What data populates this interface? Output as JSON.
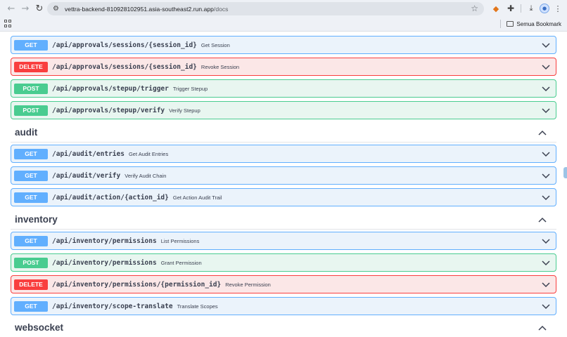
{
  "browser": {
    "url_domain": "vettra-backend-810928102951.asia-southeast2.run.app",
    "url_path": "/docs",
    "bookmarks_label": "Semua Bookmark"
  },
  "operations": [
    {
      "method": "GET",
      "path": "/api/approvals/sessions/{session_id}",
      "summary": "Get Session"
    },
    {
      "method": "DELETE",
      "path": "/api/approvals/sessions/{session_id}",
      "summary": "Revoke Session"
    },
    {
      "method": "POST",
      "path": "/api/approvals/stepup/trigger",
      "summary": "Trigger Stepup"
    },
    {
      "method": "POST",
      "path": "/api/approvals/stepup/verify",
      "summary": "Verify Stepup"
    },
    {
      "method": "GET",
      "path": "/api/audit/entries",
      "summary": "Get Audit Entries"
    },
    {
      "method": "GET",
      "path": "/api/audit/verify",
      "summary": "Verify Audit Chain"
    },
    {
      "method": "GET",
      "path": "/api/audit/action/{action_id}",
      "summary": "Get Action Audit Trail"
    },
    {
      "method": "GET",
      "path": "/api/inventory/permissions",
      "summary": "List Permissions"
    },
    {
      "method": "POST",
      "path": "/api/inventory/permissions",
      "summary": "Grant Permission"
    },
    {
      "method": "DELETE",
      "path": "/api/inventory/permissions/{permission_id}",
      "summary": "Revoke Permission"
    },
    {
      "method": "GET",
      "path": "/api/inventory/scope-translate",
      "summary": "Translate Scopes"
    }
  ],
  "tags": [
    "audit",
    "inventory",
    "websocket"
  ],
  "colors": {
    "get": "#61affe",
    "post": "#49cc90",
    "delete": "#f93e3e"
  }
}
